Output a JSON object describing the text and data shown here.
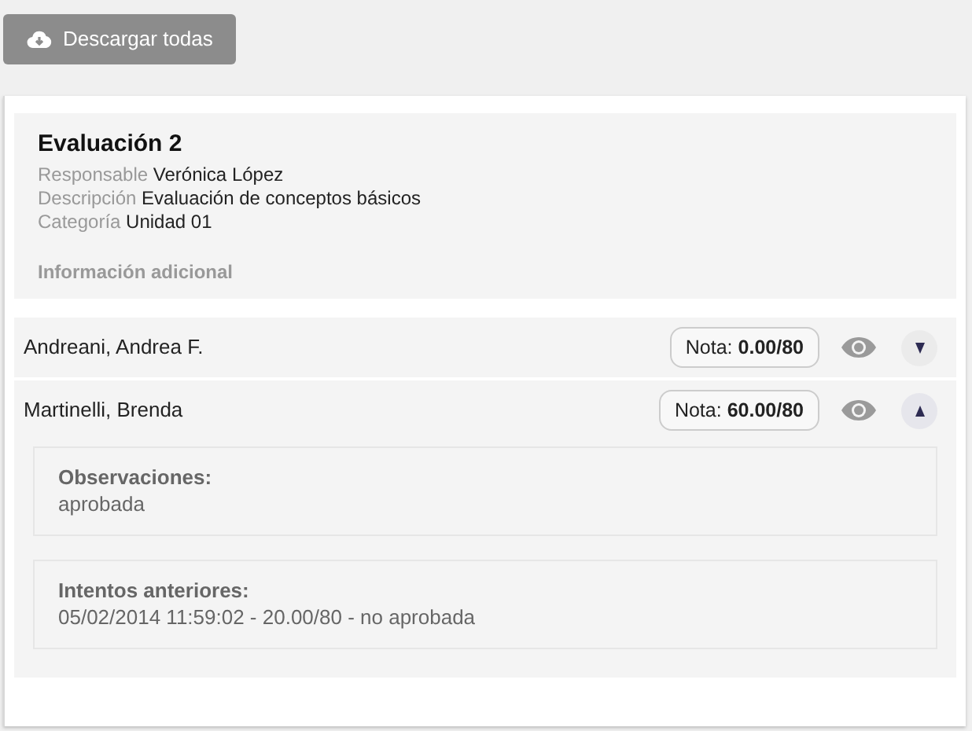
{
  "download_button": {
    "label": "Descargar todas"
  },
  "evaluation": {
    "title": "Evaluación 2",
    "fields": [
      {
        "label": "Responsable",
        "value": "Verónica López"
      },
      {
        "label": "Descripción",
        "value": "Evaluación de conceptos básicos"
      },
      {
        "label": "Categoría",
        "value": "Unidad 01"
      }
    ],
    "additional_info": "Información adicional"
  },
  "students": [
    {
      "name": "Andreani, Andrea F.",
      "grade_label": "Nota:",
      "grade": "0.00/80",
      "expanded": false
    },
    {
      "name": "Martinelli, Brenda",
      "grade_label": "Nota:",
      "grade": "60.00/80",
      "expanded": true,
      "details": [
        {
          "title": "Observaciones:",
          "text": "aprobada"
        },
        {
          "title": "Intentos anteriores:",
          "text": "05/02/2014 11:59:02 - 20.00/80 - no aprobada"
        }
      ]
    }
  ]
}
